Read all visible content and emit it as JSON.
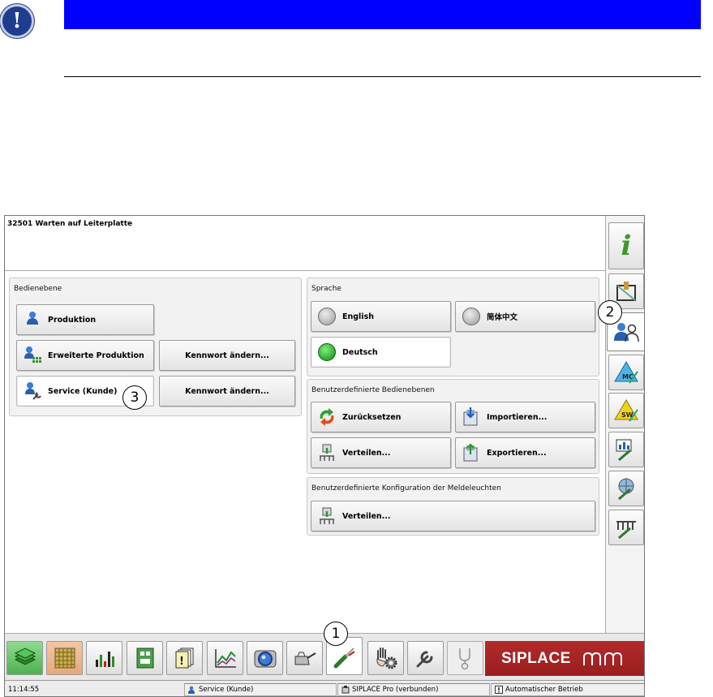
{
  "message_bar": {
    "text": "32501 Warten auf Leiterplatte"
  },
  "bedienebene": {
    "title": "Bedienebene",
    "produktion": "Produktion",
    "erweiterte": "Erweiterte Produktion",
    "service": "Service (Kunde)",
    "kennwort1": "Kennwort ändern...",
    "kennwort2": "Kennwort ändern..."
  },
  "sprache": {
    "title": "Sprache",
    "english": "English",
    "chinese": "简体中文",
    "deutsch": "Deutsch",
    "selected": "Deutsch"
  },
  "benutzer_ebenen": {
    "title": "Benutzerdefinierte Bedienebenen",
    "zuruecksetzen": "Zurücksetzen",
    "importieren": "Importieren...",
    "verteilen": "Verteilen...",
    "exportieren": "Exportieren..."
  },
  "meldeleuchten": {
    "title": "Benutzerdefinierte Konfiguration der Meldeleuchten",
    "verteilen": "Verteilen..."
  },
  "callouts": {
    "one": "1",
    "two": "2",
    "three": "3"
  },
  "logo": {
    "text": "SIPLACE"
  },
  "statusbar": {
    "time": "11:14:55",
    "user": "Service (Kunde)",
    "connection": "SIPLACE Pro (verbunden)",
    "mode": "Automatischer Betrieb"
  },
  "colors": {
    "header_bar": "#0000ff",
    "logo_bg": "#a52222",
    "radio_on": "#19a019"
  }
}
